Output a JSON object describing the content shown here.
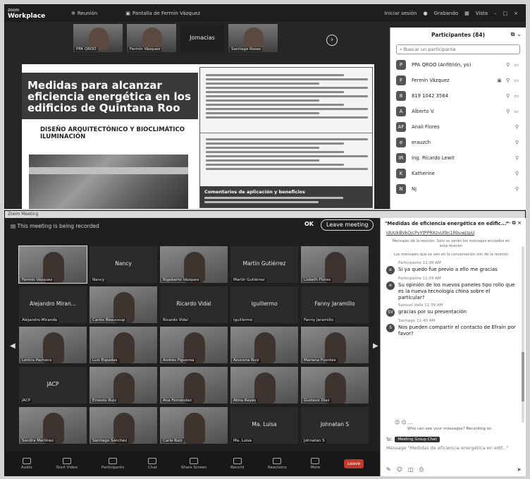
{
  "top": {
    "logo_small": "zoom",
    "logo_big": "Workplace",
    "menu_1": "Reunión",
    "speaker": "Pantalla de Fermín Vázquez",
    "host_label": "Iniciar sesión",
    "right_1": "Grabando",
    "right_2": "Vista",
    "thumbs": [
      {
        "name": "PPA QROO"
      },
      {
        "name": "Fermín Vázquez"
      },
      {
        "name": "Jomacias",
        "is_label": true
      },
      {
        "name": "Santiago Rosas"
      }
    ],
    "next": "›"
  },
  "slide": {
    "title": "Medidas para alcanzar eficiencia energética en los edificios de Quintana Roo",
    "subtitle": "DISEÑO ARQUITECTÓNICO Y BIOCLIMÁTICO ILUMINACIÓN",
    "footer_title": "Comentarios de aplicación y beneficios"
  },
  "participants": {
    "title": "Participantes (84)",
    "search_placeholder": "Buscar un participante",
    "rows": [
      {
        "avatar": "P",
        "name": "PPA QROO (Anfitrión, yo)"
      },
      {
        "avatar": "F",
        "name": "Fermín Vázquez"
      },
      {
        "avatar": "8",
        "name": "819 1042 3564"
      },
      {
        "avatar": "A",
        "name": "Alberto V."
      },
      {
        "avatar": "AF",
        "name": "Anali Flores"
      },
      {
        "avatar": "e",
        "name": "erauzch"
      },
      {
        "avatar": "IR",
        "name": "Ing. Ricardo Lewit"
      },
      {
        "avatar": "K",
        "name": "Katherine"
      },
      {
        "avatar": "N",
        "name": "Nj"
      }
    ]
  },
  "bottom": {
    "window_title": "Zoom Meeting",
    "meeting_info": "This meeting is being recorded",
    "ok": "OK",
    "leave": "Leave meeting",
    "grid": [
      {
        "name": "Fermín Vázquez",
        "video": true,
        "highlight": true
      },
      {
        "label": "Nancy",
        "name": "Nancy"
      },
      {
        "name": "Rigoberto Vázquez",
        "video": true
      },
      {
        "label": "Martín Gutiérrez",
        "name": "Martín Gutiérrez"
      },
      {
        "name": "Lizbeth Flores",
        "video": true
      },
      {
        "label": "Alejandro Miran...",
        "name": "Alejandro Miranda"
      },
      {
        "name": "Carlos Beaucoup",
        "video": true
      },
      {
        "label": "Ricardo Vidal",
        "name": "Ricardo Vidal"
      },
      {
        "label": "iguillermo",
        "name": "iguillermo"
      },
      {
        "label": "Fanny Jaramillo",
        "name": "Fanny Jaramillo"
      },
      {
        "name": "Leticia Pacheco",
        "video": true
      },
      {
        "name": "Luis Espadas",
        "video": true
      },
      {
        "name": "Andrés Figueroa",
        "video": true
      },
      {
        "name": "Azucena Ruiz",
        "video": true
      },
      {
        "name": "Mariana Fuentes",
        "video": true
      },
      {
        "label": "JACP",
        "name": "JACP"
      },
      {
        "name": "Ernesto Ruiz",
        "video": true
      },
      {
        "name": "Ana Fernández",
        "video": true
      },
      {
        "name": "Alma Reyes",
        "video": true
      },
      {
        "name": "Gustavo Díaz",
        "video": true
      },
      {
        "name": "Sandra Martínez",
        "video": true
      },
      {
        "name": "Santiago Sánchez",
        "video": true
      },
      {
        "name": "Carla Ruiz",
        "video": true
      },
      {
        "label": "Ma. Luisa",
        "name": "Ma. Luisa"
      },
      {
        "label": "Johnatan S",
        "name": "Johnatan S"
      }
    ],
    "toolbar": [
      "Audio",
      "Start Video",
      "Participants",
      "Chat",
      "Share Screen",
      "Record",
      "Reactions",
      "More"
    ],
    "leave_small": "Leave"
  },
  "chat": {
    "title": "\"Medidas de eficiencia energética en edific...\"",
    "link": "idUUkBVkOjcPvYtPPRXzvUl9n1RbuwjzpU",
    "sys1": "Mensajes de la reunión. Solo se verán los mensajes enviados en esta reunión",
    "sys2": "Los mensajes que se ven en la conversación son de la reunión",
    "messages": [
      {
        "avatar": "e",
        "who": "Participante",
        "time": "11:38 AM",
        "text": "Si ya quedo fue previo a ello me gracias"
      },
      {
        "avatar": "e",
        "who": "Participante",
        "time": "11:39 AM",
        "text": "Su opinión de los nuevos paneles tipo rollo que es la nueva tecnología china sobre el particular?"
      },
      {
        "avatar": "SV",
        "who": "Samuel Valle",
        "time": "11:39 AM",
        "text": "gracias por su presentación"
      },
      {
        "avatar": "S",
        "who": "Santiago",
        "time": "11:40 AM",
        "text": "Nos pueden compartir el contacto de Efraín por favor?"
      }
    ],
    "visibility": "Who can see your messages? Recording on",
    "to_label": "To:",
    "to_chip": "Meeting Group Chat",
    "input_placeholder": "Message \"Medidas de eficiencia energética en edif...\""
  }
}
